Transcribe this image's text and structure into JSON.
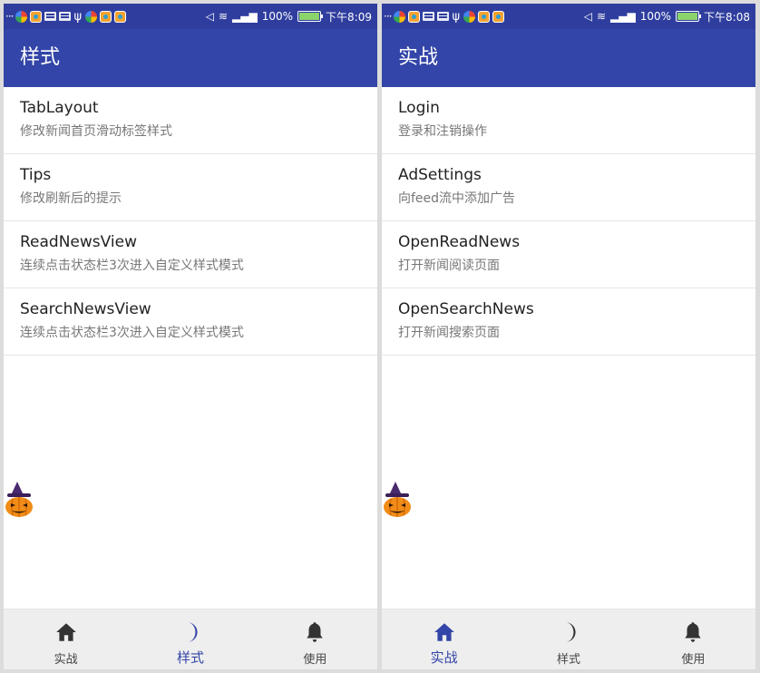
{
  "colors": {
    "primary": "#3345a8",
    "status_bar": "#2f3e9e",
    "inactive_icon": "#333333",
    "divider": "#e6e6e6"
  },
  "screens": [
    {
      "status": {
        "battery": "100%",
        "time": "下午8:09"
      },
      "title": "样式",
      "items": [
        {
          "title": "TabLayout",
          "subtitle": "修改新闻首页滑动标签样式"
        },
        {
          "title": "Tips",
          "subtitle": "修改刷新后的提示"
        },
        {
          "title": "ReadNewsView",
          "subtitle": "连续点击状态栏3次进入自定义样式模式"
        },
        {
          "title": "SearchNewsView",
          "subtitle": "连续点击状态栏3次进入自定义样式模式"
        }
      ],
      "nav": [
        {
          "label": "实战",
          "icon": "home-icon",
          "active": false
        },
        {
          "label": "样式",
          "icon": "moon-icon",
          "active": true
        },
        {
          "label": "使用",
          "icon": "bell-icon",
          "active": false
        }
      ]
    },
    {
      "status": {
        "battery": "100%",
        "time": "下午8:08"
      },
      "title": "实战",
      "items": [
        {
          "title": "Login",
          "subtitle": "登录和注销操作"
        },
        {
          "title": "AdSettings",
          "subtitle": "向feed流中添加广告"
        },
        {
          "title": "OpenReadNews",
          "subtitle": "打开新闻阅读页面"
        },
        {
          "title": "OpenSearchNews",
          "subtitle": "打开新闻搜索页面"
        }
      ],
      "nav": [
        {
          "label": "实战",
          "icon": "home-icon",
          "active": true
        },
        {
          "label": "样式",
          "icon": "moon-icon",
          "active": false
        },
        {
          "label": "使用",
          "icon": "bell-icon",
          "active": false
        }
      ]
    }
  ]
}
